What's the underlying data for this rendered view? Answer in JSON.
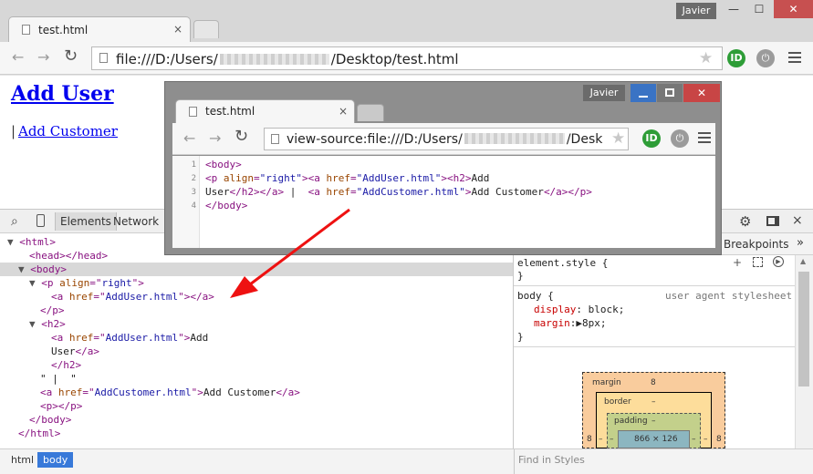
{
  "main_window": {
    "tab_title": "test.html",
    "tab_close": "×",
    "user_badge": "Javier",
    "minimize": "—",
    "maximize": "☐",
    "close": "✕",
    "address_prefix": "file:///D:/Users/",
    "address_suffix": "/Desktop/test.html",
    "back": "←",
    "forward": "→",
    "reload": "↻",
    "star": "★",
    "ext1": "ID",
    "ext2": "⏻"
  },
  "page": {
    "add_user": "Add User",
    "separator": "|",
    "add_customer": "Add Customer"
  },
  "devtools": {
    "tabs": {
      "elements": "Elements",
      "network": "Network"
    },
    "right_tab": "Breakpoints",
    "more": "»",
    "close": "×",
    "dom_lines": [
      {
        "parts": [
          [
            "tri",
            "▼ "
          ],
          [
            "tag",
            "<html>"
          ]
        ]
      },
      {
        "parts": [
          [
            "tag",
            "<head></head>"
          ]
        ]
      },
      {
        "parts": [
          [
            "tri",
            "▼ "
          ],
          [
            "tag",
            "<body>"
          ]
        ]
      },
      {
        "parts": [
          [
            "tri",
            "▼ "
          ],
          [
            "tag",
            "<p "
          ],
          [
            "attr",
            "align"
          ],
          [
            "tag",
            "=\""
          ],
          [
            "val",
            "right"
          ],
          [
            "tag",
            "\">"
          ]
        ]
      },
      {
        "parts": [
          [
            "tag",
            "<a "
          ],
          [
            "attr",
            "href"
          ],
          [
            "tag",
            "=\""
          ],
          [
            "val",
            "AddUser.html"
          ],
          [
            "tag",
            "\"></a>"
          ]
        ]
      },
      {
        "parts": [
          [
            "tag",
            "</p>"
          ]
        ]
      },
      {
        "parts": [
          [
            "tri",
            "▼ "
          ],
          [
            "tag",
            "<h2>"
          ]
        ]
      },
      {
        "parts": [
          [
            "tag",
            "<a "
          ],
          [
            "attr",
            "href"
          ],
          [
            "tag",
            "=\""
          ],
          [
            "val",
            "AddUser.html"
          ],
          [
            "tag",
            "\">"
          ],
          [
            "txt",
            "Add"
          ]
        ]
      },
      {
        "parts": [
          [
            "txt",
            "User"
          ],
          [
            "tag",
            "</a>"
          ]
        ]
      },
      {
        "parts": [
          [
            "tag",
            "</h2>"
          ]
        ]
      },
      {
        "parts": [
          [
            "txt",
            "\" |  \""
          ]
        ]
      },
      {
        "parts": [
          [
            "tag",
            "<a "
          ],
          [
            "attr",
            "href"
          ],
          [
            "tag",
            "=\""
          ],
          [
            "val",
            "AddCustomer.html"
          ],
          [
            "tag",
            "\">"
          ],
          [
            "txt",
            "Add Customer"
          ],
          [
            "tag",
            "</a>"
          ]
        ]
      },
      {
        "parts": [
          [
            "tag",
            "<p></p>"
          ]
        ]
      },
      {
        "parts": [
          [
            "tag",
            "</body>"
          ]
        ]
      },
      {
        "parts": [
          [
            "tag",
            "</html>"
          ]
        ]
      }
    ],
    "styles": {
      "element_style": "element.style {",
      "close_brace": "}",
      "body_selector": "body {",
      "ua_label": "user agent stylesheet",
      "decl1_prop": "display",
      "decl1_val": ": block;",
      "decl2_prop": "margin",
      "decl2_val": ":▶8px;"
    },
    "box_model": {
      "margin_label": "margin",
      "margin_value": "8",
      "border_label": "border",
      "border_value": "–",
      "padding_label": "padding",
      "padding_value": "–",
      "content_size": "866 × 126",
      "side_left": "8",
      "side_right": "8",
      "dash": "–"
    },
    "footer": {
      "crumb_html": "html",
      "crumb_body": "body",
      "find_placeholder": "Find in Styles"
    }
  },
  "popup": {
    "tab_title": "test.html",
    "tab_close": "×",
    "user_badge": "Javier",
    "address_prefix": "view-source:file:///D:/Users/",
    "address_suffix": "/Desk",
    "code_lines": [
      {
        "num": "1",
        "parts": [
          [
            "tag",
            "<body>"
          ]
        ]
      },
      {
        "num": "2",
        "parts": [
          [
            "tag",
            "<p "
          ],
          [
            "attr",
            "align"
          ],
          [
            "tag",
            "="
          ],
          [
            "val",
            "\"right\""
          ],
          [
            "tag",
            "><a "
          ],
          [
            "attr",
            "href"
          ],
          [
            "tag",
            "="
          ],
          [
            "val",
            "\"AddUser.html\""
          ],
          [
            "tag",
            "><h2>"
          ],
          [
            "txt",
            "Add"
          ]
        ]
      },
      {
        "num": "3",
        "parts": [
          [
            "txt",
            "User"
          ],
          [
            "tag",
            "</h2></a>"
          ],
          [
            "txt",
            " |  "
          ],
          [
            "tag",
            "<a "
          ],
          [
            "attr",
            "href"
          ],
          [
            "tag",
            "="
          ],
          [
            "val",
            "\"AddCustomer.html\""
          ],
          [
            "tag",
            ">"
          ],
          [
            "txt",
            "Add Customer"
          ],
          [
            "tag",
            "</a></p>"
          ]
        ]
      },
      {
        "num": "4",
        "parts": [
          [
            "tag",
            "</body>"
          ]
        ]
      }
    ]
  },
  "colors": {
    "annotation_arrow": "#ee1111",
    "link": "#0000ee",
    "tag": "#881280"
  }
}
